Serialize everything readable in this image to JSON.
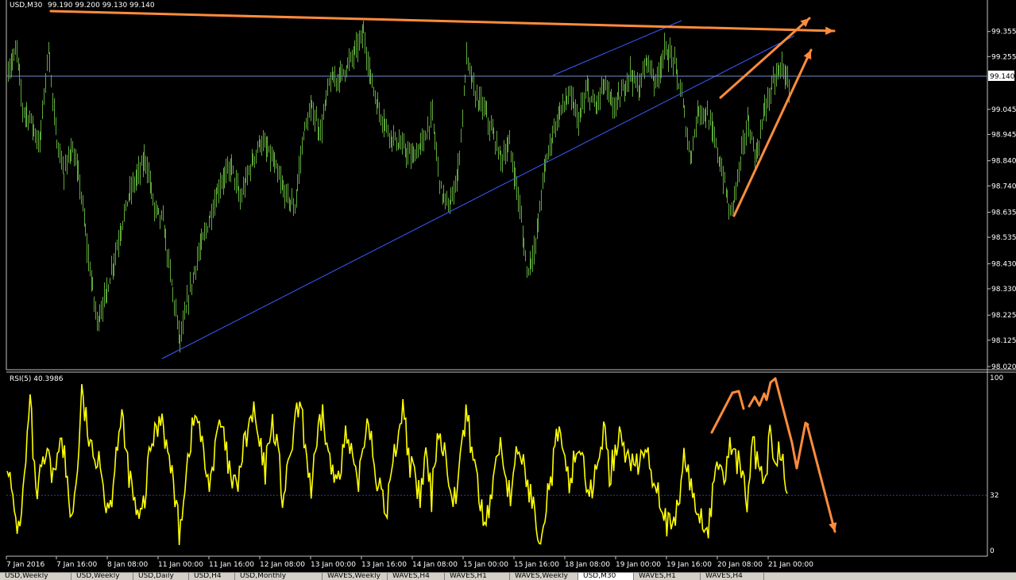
{
  "chart_data": [
    {
      "type": "bar",
      "style": "ohlc",
      "title": "USD,M30",
      "ohlc_readout": "99.190 99.200 99.130 99.140",
      "current_price": "99.140",
      "ylim": [
        98.02,
        99.43
      ],
      "ytick_labels": [
        "99.355",
        "99.255",
        "99.140",
        "99.045",
        "98.945",
        "98.840",
        "98.740",
        "98.635",
        "98.535",
        "98.430",
        "98.330",
        "98.225",
        "98.125",
        "98.020"
      ],
      "xtick_labels": [
        "7 Jan 2016",
        "7 Jan 16:00",
        "8 Jan 08:00",
        "11 Jan 00:00",
        "11 Jan 16:00",
        "12 Jan 08:00",
        "13 Jan 00:00",
        "13 Jan 16:00",
        "14 Jan 08:00",
        "15 Jan 00:00",
        "15 Jan 16:00",
        "18 Jan 08:00",
        "19 Jan 00:00",
        "19 Jan 16:00",
        "20 Jan 08:00",
        "21 Jan 00:00"
      ],
      "bar_color": "#5fa83a",
      "grid": false,
      "keypoints": [
        [
          0,
          99.2
        ],
        [
          6,
          99.28
        ],
        [
          10,
          99.05
        ],
        [
          16,
          99.0
        ],
        [
          22,
          98.9
        ],
        [
          28,
          99.3
        ],
        [
          33,
          98.95
        ],
        [
          39,
          98.78
        ],
        [
          44,
          98.9
        ],
        [
          50,
          98.75
        ],
        [
          56,
          98.45
        ],
        [
          62,
          98.2
        ],
        [
          68,
          98.3
        ],
        [
          76,
          98.5
        ],
        [
          84,
          98.7
        ],
        [
          90,
          98.78
        ],
        [
          96,
          98.85
        ],
        [
          102,
          98.65
        ],
        [
          108,
          98.6
        ],
        [
          114,
          98.35
        ],
        [
          120,
          98.12
        ],
        [
          126,
          98.3
        ],
        [
          132,
          98.45
        ],
        [
          140,
          98.6
        ],
        [
          148,
          98.75
        ],
        [
          156,
          98.82
        ],
        [
          162,
          98.68
        ],
        [
          168,
          98.8
        ],
        [
          176,
          98.92
        ],
        [
          184,
          98.85
        ],
        [
          192,
          98.72
        ],
        [
          200,
          98.65
        ],
        [
          206,
          98.95
        ],
        [
          212,
          99.05
        ],
        [
          218,
          98.95
        ],
        [
          224,
          99.15
        ],
        [
          232,
          99.18
        ],
        [
          240,
          99.25
        ],
        [
          248,
          99.35
        ],
        [
          252,
          99.2
        ],
        [
          258,
          99.05
        ],
        [
          266,
          98.95
        ],
        [
          274,
          98.9
        ],
        [
          282,
          98.85
        ],
        [
          290,
          98.92
        ],
        [
          296,
          99.02
        ],
        [
          302,
          98.72
        ],
        [
          308,
          98.65
        ],
        [
          314,
          98.8
        ],
        [
          320,
          99.25
        ],
        [
          326,
          99.1
        ],
        [
          332,
          99.05
        ],
        [
          338,
          98.95
        ],
        [
          344,
          98.85
        ],
        [
          350,
          98.9
        ],
        [
          356,
          98.7
        ],
        [
          362,
          98.4
        ],
        [
          368,
          98.5
        ],
        [
          374,
          98.8
        ],
        [
          380,
          98.95
        ],
        [
          386,
          99.05
        ],
        [
          392,
          99.1
        ],
        [
          398,
          99.0
        ],
        [
          404,
          99.12
        ],
        [
          410,
          99.05
        ],
        [
          416,
          99.15
        ],
        [
          422,
          99.05
        ],
        [
          428,
          99.1
        ],
        [
          434,
          99.2
        ],
        [
          440,
          99.12
        ],
        [
          446,
          99.25
        ],
        [
          452,
          99.15
        ],
        [
          458,
          99.28
        ],
        [
          464,
          99.25
        ],
        [
          470,
          99.1
        ],
        [
          476,
          98.85
        ],
        [
          482,
          99.05
        ],
        [
          488,
          99.02
        ],
        [
          494,
          98.9
        ],
        [
          500,
          98.75
        ],
        [
          504,
          98.62
        ],
        [
          510,
          98.8
        ],
        [
          516,
          99.0
        ],
        [
          522,
          98.85
        ],
        [
          528,
          99.05
        ],
        [
          534,
          99.15
        ],
        [
          540,
          99.22
        ],
        [
          545,
          99.13
        ]
      ]
    },
    {
      "type": "line",
      "title": "RSI(5) 40.3986",
      "ylim": [
        0,
        100
      ],
      "ytick_labels": [
        "100",
        "32",
        "0"
      ],
      "level": 32,
      "line_color": "#ffff00",
      "keypoints": [
        [
          0,
          55
        ],
        [
          4,
          25
        ],
        [
          8,
          12
        ],
        [
          12,
          40
        ],
        [
          16,
          88
        ],
        [
          20,
          30
        ],
        [
          24,
          45
        ],
        [
          28,
          55
        ],
        [
          32,
          40
        ],
        [
          36,
          65
        ],
        [
          40,
          55
        ],
        [
          44,
          20
        ],
        [
          48,
          35
        ],
        [
          52,
          90
        ],
        [
          56,
          70
        ],
        [
          60,
          50
        ],
        [
          64,
          60
        ],
        [
          68,
          30
        ],
        [
          72,
          25
        ],
        [
          76,
          60
        ],
        [
          80,
          75
        ],
        [
          84,
          50
        ],
        [
          88,
          30
        ],
        [
          92,
          15
        ],
        [
          96,
          30
        ],
        [
          100,
          60
        ],
        [
          104,
          70
        ],
        [
          108,
          80
        ],
        [
          112,
          55
        ],
        [
          116,
          40
        ],
        [
          120,
          10
        ],
        [
          124,
          40
        ],
        [
          128,
          65
        ],
        [
          132,
          80
        ],
        [
          136,
          60
        ],
        [
          140,
          40
        ],
        [
          144,
          50
        ],
        [
          148,
          75
        ],
        [
          152,
          60
        ],
        [
          156,
          40
        ],
        [
          160,
          35
        ],
        [
          164,
          55
        ],
        [
          168,
          70
        ],
        [
          172,
          80
        ],
        [
          176,
          60
        ],
        [
          180,
          45
        ],
        [
          184,
          75
        ],
        [
          188,
          65
        ],
        [
          192,
          30
        ],
        [
          196,
          45
        ],
        [
          200,
          70
        ],
        [
          204,
          85
        ],
        [
          208,
          60
        ],
        [
          212,
          35
        ],
        [
          216,
          60
        ],
        [
          220,
          80
        ],
        [
          224,
          55
        ],
        [
          228,
          40
        ],
        [
          232,
          50
        ],
        [
          236,
          65
        ],
        [
          240,
          55
        ],
        [
          244,
          35
        ],
        [
          248,
          60
        ],
        [
          252,
          80
        ],
        [
          256,
          50
        ],
        [
          260,
          35
        ],
        [
          264,
          20
        ],
        [
          268,
          45
        ],
        [
          272,
          65
        ],
        [
          276,
          85
        ],
        [
          280,
          55
        ],
        [
          284,
          40
        ],
        [
          288,
          30
        ],
        [
          292,
          55
        ],
        [
          296,
          30
        ],
        [
          300,
          70
        ],
        [
          304,
          60
        ],
        [
          308,
          45
        ],
        [
          312,
          30
        ],
        [
          316,
          50
        ],
        [
          320,
          80
        ],
        [
          324,
          60
        ],
        [
          328,
          40
        ],
        [
          332,
          15
        ],
        [
          336,
          25
        ],
        [
          340,
          45
        ],
        [
          344,
          65
        ],
        [
          348,
          40
        ],
        [
          352,
          30
        ],
        [
          356,
          60
        ],
        [
          360,
          50
        ],
        [
          364,
          35
        ],
        [
          368,
          20
        ],
        [
          372,
          10
        ],
        [
          376,
          30
        ],
        [
          380,
          45
        ],
        [
          384,
          70
        ],
        [
          388,
          50
        ],
        [
          392,
          40
        ],
        [
          396,
          55
        ],
        [
          400,
          60
        ],
        [
          404,
          40
        ],
        [
          408,
          30
        ],
        [
          412,
          55
        ],
        [
          416,
          70
        ],
        [
          420,
          45
        ],
        [
          424,
          55
        ],
        [
          428,
          75
        ],
        [
          432,
          50
        ],
        [
          436,
          55
        ],
        [
          440,
          45
        ],
        [
          444,
          60
        ],
        [
          448,
          50
        ],
        [
          452,
          40
        ],
        [
          456,
          30
        ],
        [
          460,
          15
        ],
        [
          464,
          10
        ],
        [
          468,
          25
        ],
        [
          472,
          55
        ],
        [
          476,
          40
        ],
        [
          480,
          25
        ],
        [
          484,
          20
        ],
        [
          488,
          10
        ],
        [
          492,
          30
        ],
        [
          496,
          55
        ],
        [
          500,
          40
        ],
        [
          504,
          60
        ],
        [
          508,
          55
        ],
        [
          512,
          45
        ],
        [
          516,
          30
        ],
        [
          520,
          60
        ],
        [
          524,
          50
        ],
        [
          528,
          35
        ],
        [
          532,
          65
        ],
        [
          536,
          55
        ],
        [
          540,
          60
        ],
        [
          544,
          38
        ]
      ]
    }
  ],
  "tabs": [
    "USD,Weekly",
    "USD,Weekly",
    "USD,Daily",
    "USD,H4",
    "USD,Monthly",
    "WAVES,Weekly",
    "WAVES,H4",
    "WAVES,H1",
    "WAVES,Weekly",
    "USD,M30",
    "WAVES,H1",
    "WAVES,H4"
  ],
  "active_tab_index": 9
}
